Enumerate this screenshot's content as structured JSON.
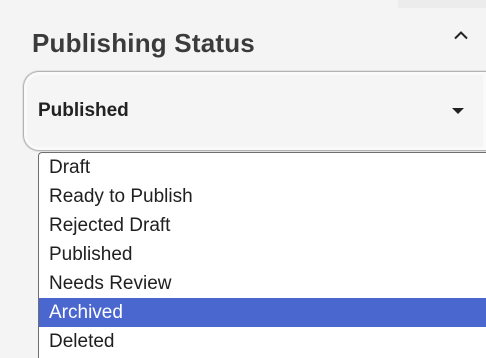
{
  "panel": {
    "title": "Publishing Status",
    "collapse_icon": "chevron-up-icon"
  },
  "status_select": {
    "selected_value": "Published",
    "caret_icon": "caret-down-icon"
  },
  "dropdown": {
    "options": [
      {
        "label": "Draft",
        "highlighted": false
      },
      {
        "label": "Ready to Publish",
        "highlighted": false
      },
      {
        "label": "Rejected Draft",
        "highlighted": false
      },
      {
        "label": "Published",
        "highlighted": false
      },
      {
        "label": "Needs Review",
        "highlighted": false
      },
      {
        "label": "Archived",
        "highlighted": true
      },
      {
        "label": "Deleted",
        "highlighted": false
      }
    ],
    "highlight_color": "#4a66cf"
  }
}
